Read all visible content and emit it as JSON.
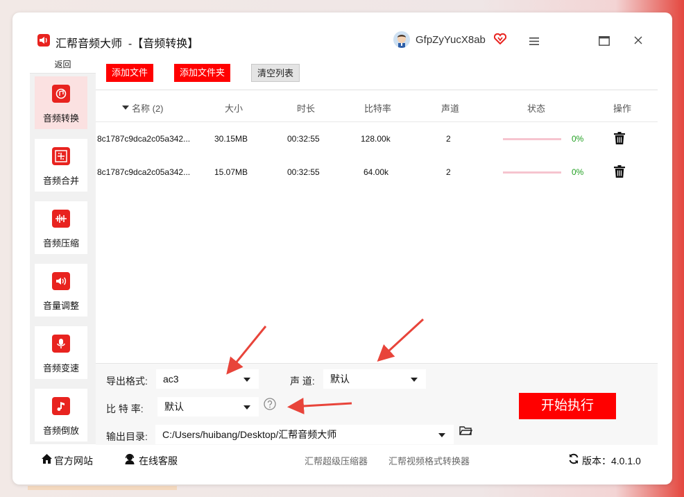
{
  "app": {
    "title": "汇帮音频大师  -【音频转换】",
    "username": "GfpZyYucX8ab"
  },
  "colors": {
    "accent": "#ff0000",
    "brand": "#e8231f",
    "progress_track": "#f6c4cf",
    "success": "#22a022"
  },
  "sidebar": {
    "back_label": "返回",
    "items": [
      {
        "label": "音频转换",
        "icon": "audio-convert-icon",
        "active": true
      },
      {
        "label": "音频合并",
        "icon": "audio-merge-icon"
      },
      {
        "label": "音频压缩",
        "icon": "audio-compress-icon"
      },
      {
        "label": "音量调整",
        "icon": "volume-icon"
      },
      {
        "label": "音频变速",
        "icon": "microphone-icon"
      },
      {
        "label": "音频倒放",
        "icon": "music-note-icon"
      }
    ]
  },
  "toolbar": {
    "add_file": "添加文件",
    "add_folder": "添加文件夹",
    "clear_list": "清空列表"
  },
  "table": {
    "headers": {
      "name": "名称 (2)",
      "size": "大小",
      "duration": "时长",
      "bitrate": "比特率",
      "channels": "声道",
      "status": "状态",
      "actions": "操作"
    },
    "rows": [
      {
        "name": "8c1787c9dca2c05a342...",
        "size": "30.15MB",
        "duration": "00:32:55",
        "bitrate": "128.00k",
        "channels": "2",
        "progress": 0,
        "progress_label": "0%"
      },
      {
        "name": "8c1787c9dca2c05a342...",
        "size": "15.07MB",
        "duration": "00:32:55",
        "bitrate": "64.00k",
        "channels": "2",
        "progress": 0,
        "progress_label": "0%"
      }
    ]
  },
  "settings": {
    "format_label": "导出格式:",
    "format_value": "ac3",
    "channel_label": "声 道:",
    "channel_value": "默认",
    "bitrate_label": "比 特 率:",
    "bitrate_value": "默认",
    "output_label": "输出目录:",
    "output_value": "C:/Users/huibang/Desktop/汇帮音频大师",
    "start_label": "开始执行"
  },
  "footer": {
    "website": "官方网站",
    "support": "在线客服",
    "link1": "汇帮超级压缩器",
    "link2": "汇帮视频格式转换器",
    "version": "版本：4.0.1.0"
  }
}
